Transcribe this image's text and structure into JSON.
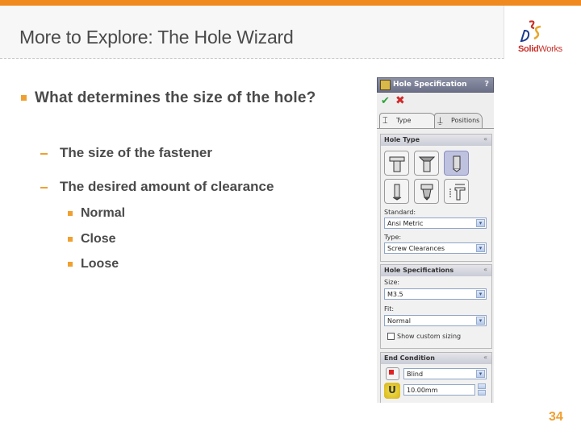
{
  "slide": {
    "title": "More to Explore: The Hole Wizard",
    "page_number": "34",
    "accent_color": "#f0891e",
    "logo": {
      "name": "solidworks-logo",
      "text_bold": "Solid",
      "text_regular": "Works"
    }
  },
  "bullets": {
    "main": "What determines the size of the hole?",
    "sub": [
      {
        "text": "The size of the fastener"
      },
      {
        "text": "The desired amount of clearance"
      }
    ],
    "subsub": [
      {
        "text": "Normal"
      },
      {
        "text": "Close"
      },
      {
        "text": "Loose"
      }
    ]
  },
  "property_manager": {
    "title": "Hole Specification",
    "help": "?",
    "ok_icon": "checkmark-icon",
    "cancel_icon": "x-icon",
    "tabs": [
      {
        "label": "Type",
        "icon": "hole-type-icon",
        "active": true
      },
      {
        "label": "Positions",
        "icon": "positions-icon",
        "active": false
      }
    ],
    "hole_type": {
      "header": "Hole Type",
      "collapse": "«",
      "buttons": [
        {
          "name": "counterbore",
          "selected": false
        },
        {
          "name": "countersink",
          "selected": false
        },
        {
          "name": "hole",
          "selected": true
        },
        {
          "name": "straight-tap",
          "selected": false
        },
        {
          "name": "tapered-tap",
          "selected": false
        },
        {
          "name": "legacy-hole",
          "selected": false
        }
      ],
      "standard_label": "Standard:",
      "standard_value": "Ansi Metric",
      "type_label": "Type:",
      "type_value": "Screw Clearances"
    },
    "hole_spec": {
      "header": "Hole Specifications",
      "collapse": "«",
      "size_label": "Size:",
      "size_value": "M3.5",
      "fit_label": "Fit:",
      "fit_value": "Normal",
      "custom_sizing_label": "Show custom sizing",
      "custom_sizing_checked": false
    },
    "end_condition": {
      "header": "End Condition",
      "collapse": "«",
      "value": "Blind",
      "depth": "10.00mm"
    }
  }
}
